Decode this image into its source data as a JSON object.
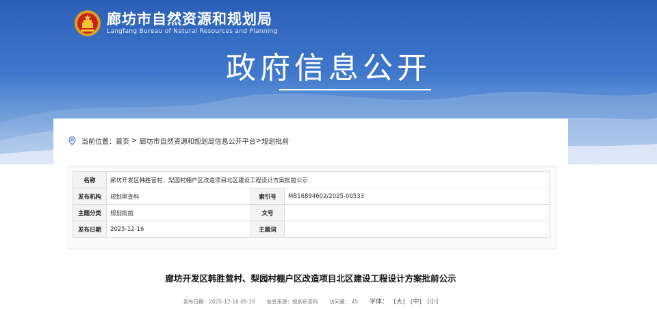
{
  "header": {
    "site_title": "廊坊市自然资源和规划局",
    "site_subtitle": "Langfang Bureau of Natural Resources and Planning",
    "hero_text": "政府信息公开"
  },
  "breadcrumb": {
    "prefix": "当前位置：",
    "home": "首页",
    "sep1": " > ",
    "platform": "廊坊市自然资源和规划局信息公开平台",
    "sep2": ">",
    "current": "规划批前"
  },
  "meta": {
    "name_label": "名称",
    "name_value": "廊坊开发区韩胜营村、梨园村棚户区改造项目北区建设工程设计方案批前公示",
    "org_label": "发布机构",
    "org_value": "规划审查科",
    "index_label": "索引号",
    "index_value": "MB16894602/2025-00533",
    "topic_label": "主题分类",
    "topic_value": "规划批前",
    "docno_label": "文号",
    "docno_value": "",
    "date_label": "发布日期",
    "date_value": "2025-12-16",
    "subject_label": "主题词",
    "subject_value": ""
  },
  "article": {
    "title": "廊坊开发区韩胜营村、梨园村棚户区改造项目北区建设工程设计方案批前公示",
    "publish_label": "发布日期：",
    "publish_value": "2025-12-16 09:19",
    "source_label": "信息来源：",
    "source_value": "规划审查科",
    "visits_label": "访问量：",
    "visits_value": "45",
    "font_label": "字体：",
    "font_large": "[大]",
    "font_medium": "[中]",
    "font_small": "[小]"
  },
  "colors": {
    "banner_top": "#2c5fb7",
    "banner_bottom": "#dbe7f6"
  },
  "icons": {
    "emblem": "national-emblem-icon",
    "location": "location-pin-icon"
  }
}
